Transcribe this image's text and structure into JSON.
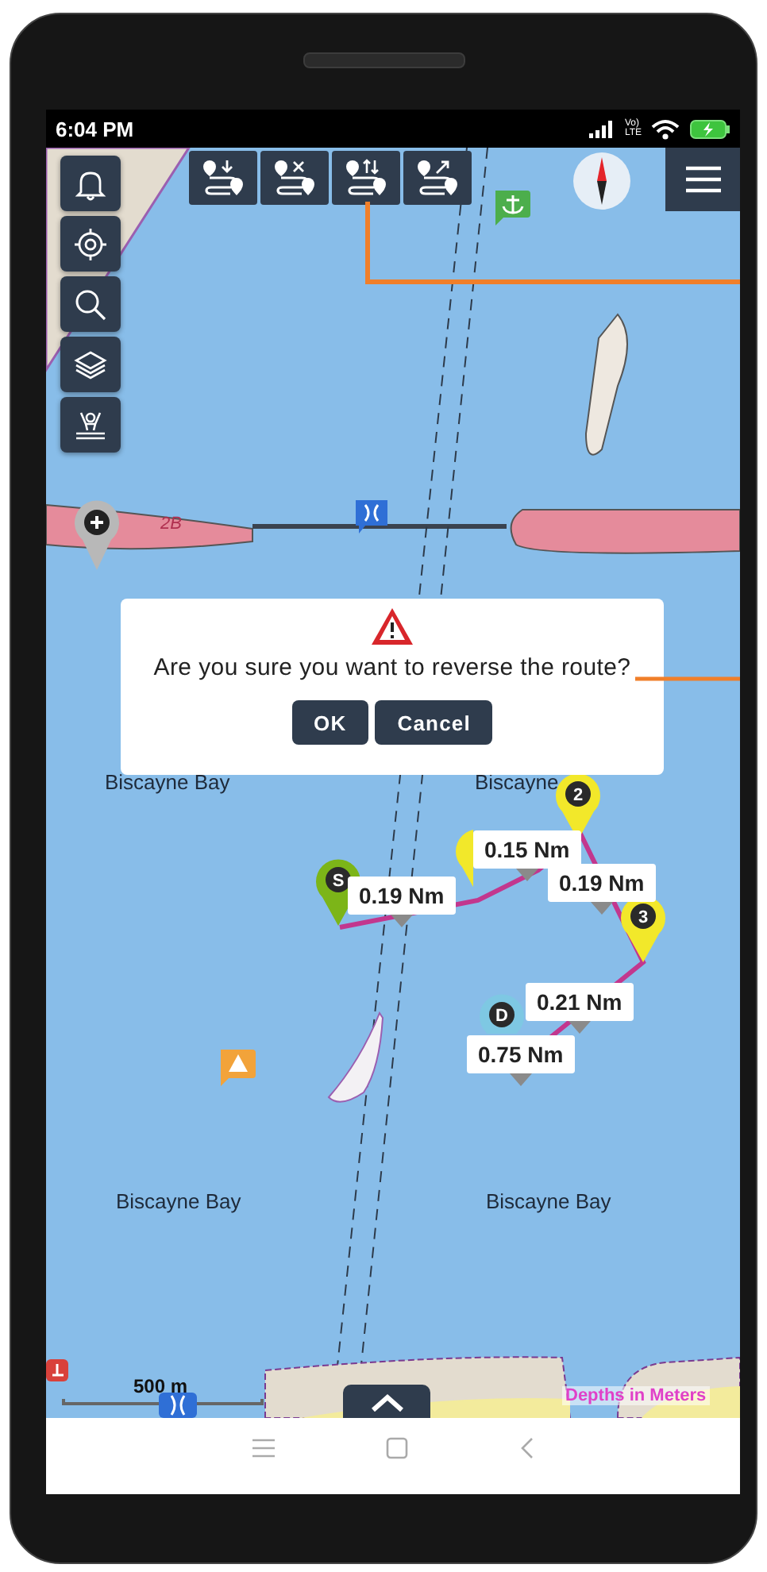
{
  "status_bar": {
    "time": "6:04 PM",
    "volte": [
      "Vo)",
      "LTE"
    ]
  },
  "map": {
    "side_tools": [
      {
        "kind": "bell"
      },
      {
        "kind": "locate"
      },
      {
        "kind": "search"
      },
      {
        "kind": "layers"
      },
      {
        "kind": "overboard"
      }
    ],
    "route_tools": [
      {
        "kind": "add"
      },
      {
        "kind": "delete"
      },
      {
        "kind": "reverse"
      },
      {
        "kind": "navigate"
      }
    ],
    "area_label": "2B",
    "place_labels": [
      {
        "text": "Biscayne Bay"
      },
      {
        "text": "Biscayne"
      },
      {
        "text": "Biscayne Bay"
      },
      {
        "text": "Biscayne Bay"
      }
    ],
    "pins": [
      {
        "label": "S",
        "color": "#7cb518"
      },
      {
        "color": "#f2e82a"
      },
      {
        "label": "2",
        "color": "#f2e82a"
      },
      {
        "label": "3",
        "color": "#f2e82a"
      },
      {
        "label": "D",
        "color": "#7ec8e3"
      }
    ],
    "distances": [
      {
        "text": "0.15 Nm"
      },
      {
        "text": "0.19 Nm"
      },
      {
        "text": "0.19 Nm"
      },
      {
        "text": "0.21 Nm"
      },
      {
        "text": "0.75 Nm"
      }
    ],
    "scale": "500 m",
    "depth_note": "Depths in Meters"
  },
  "dialog": {
    "message": "Are you sure you want to reverse the route?",
    "buttons": [
      "OK",
      "Cancel"
    ]
  }
}
